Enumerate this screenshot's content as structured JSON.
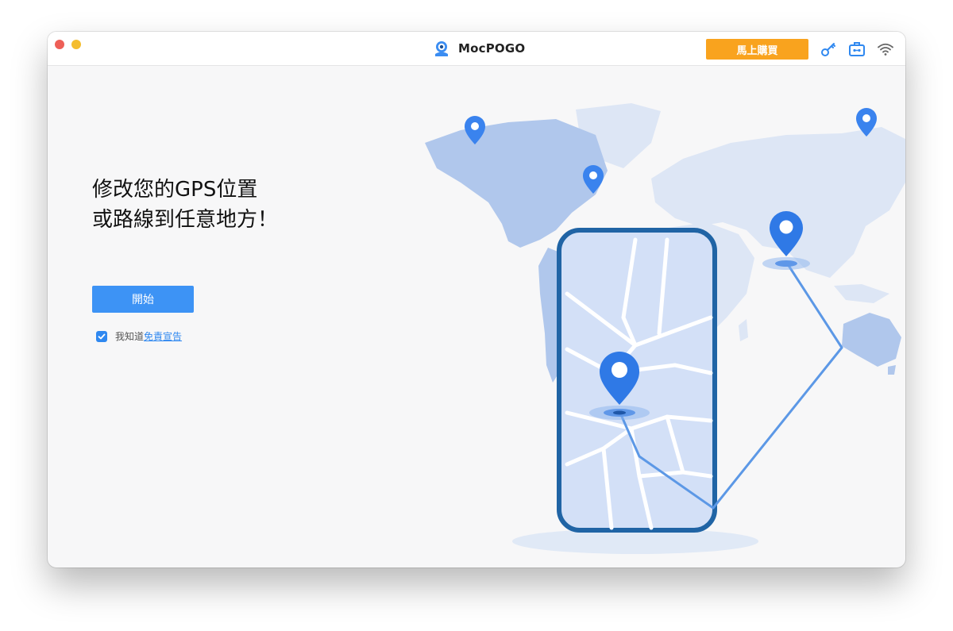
{
  "titlebar": {
    "app_name": "MocPOGO",
    "buy_label": "馬上購買",
    "icons": [
      "app-logo-icon",
      "key-icon",
      "toolbox-icon",
      "wifi-icon"
    ],
    "accent_color": "#f9a31e"
  },
  "main": {
    "headline_line1": "修改您的GPS位置",
    "headline_line2": "或路線到任意地方！",
    "start_label": "開始",
    "agree_prefix": "我知道",
    "disclaimer_link": "免責宣告",
    "agree_checked": true,
    "primary_color": "#3d93f5"
  }
}
